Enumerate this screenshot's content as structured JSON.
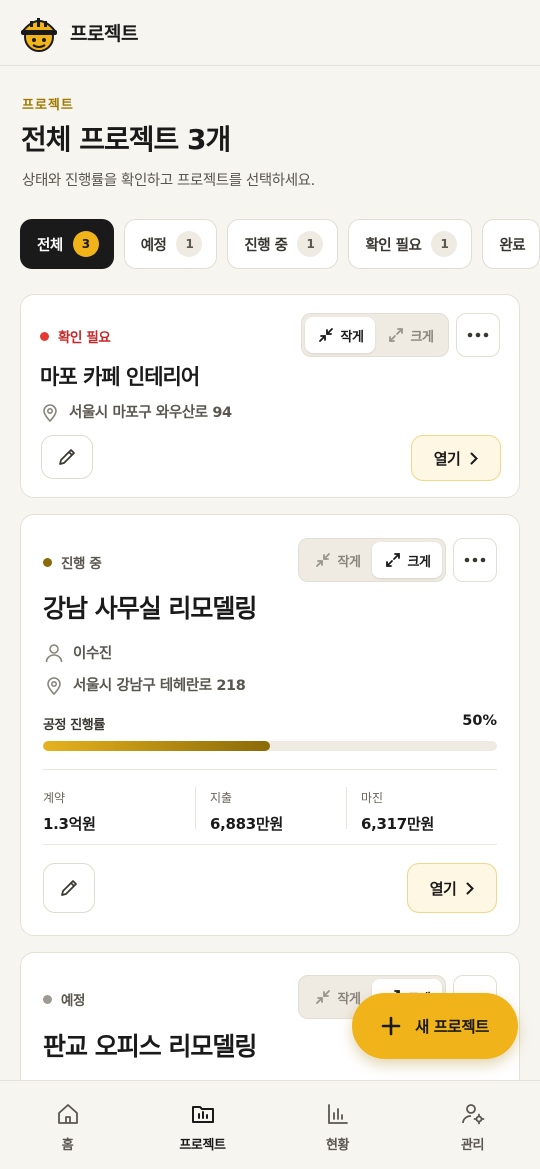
{
  "header": {
    "title": "프로젝트",
    "logo_icon": "hardhat-worker-icon"
  },
  "page": {
    "eyebrow": "프로젝트",
    "title": "전체 프로젝트 3개",
    "subtitle": "상태와 진행률을 확인하고 프로젝트를 선택하세요."
  },
  "filters": [
    {
      "label": "전체",
      "count": "3",
      "active": true
    },
    {
      "label": "예정",
      "count": "1"
    },
    {
      "label": "진행 중",
      "count": "1"
    },
    {
      "label": "확인 필요",
      "count": "1"
    },
    {
      "label": "완료",
      "count": ""
    }
  ],
  "view_toggle": {
    "compact": "작게",
    "expanded": "크게"
  },
  "open_label": "열기",
  "projects": [
    {
      "status": "확인 필요",
      "status_color": "#e53935",
      "title": "마포 카페 인테리어",
      "address": "서울시 마포구 와우산로 94",
      "view": "compact"
    },
    {
      "status": "진행 중",
      "status_color": "#8a6a08",
      "title": "강남 사무실 리모델링",
      "manager": "이수진",
      "address": "서울시 강남구 테헤란로 218",
      "view": "expanded",
      "progress_label": "공정 진행률",
      "progress_text": "50%",
      "progress": 0.5,
      "stats": [
        {
          "label": "계약",
          "value": "1.3억원"
        },
        {
          "label": "지출",
          "value": "6,883만원"
        },
        {
          "label": "마진",
          "value": "6,317만원"
        }
      ]
    },
    {
      "status": "예정",
      "status_color": "#9e9a93",
      "title": "판교 오피스 리모델링",
      "view": "compact"
    }
  ],
  "fab": {
    "label": "새 프로젝트"
  },
  "tabs": [
    {
      "label": "홈",
      "icon": "home-icon"
    },
    {
      "label": "프로젝트",
      "icon": "folder-chart-icon",
      "active": true
    },
    {
      "label": "현황",
      "icon": "bar-chart-icon"
    },
    {
      "label": "관리",
      "icon": "user-settings-icon"
    }
  ],
  "colors": {
    "accent": "#f0b41a",
    "background": "#f7f5f0",
    "dark": "#1a1a1a"
  }
}
